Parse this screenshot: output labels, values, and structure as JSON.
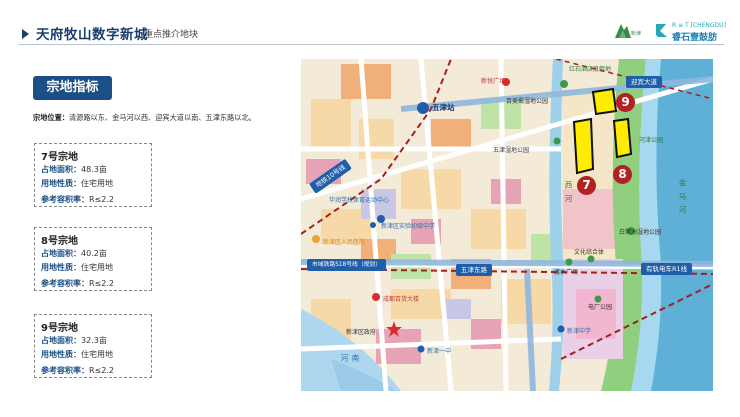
{
  "header": {
    "title": "天府牧山数字新城",
    "subtitle": "重点推介地块",
    "logo1_text": "新津",
    "logo2_en": "R ≡ T [CHENGDU]",
    "logo2_cn": "睿石壹鼓肪"
  },
  "section": {
    "title": "宗地指标",
    "location_label": "宗地位置：",
    "location_text": "清源路以东、金马河以西、迎宾大道以南、五津东路以北。"
  },
  "plots": [
    {
      "title": "7号宗地",
      "area_label": "占地面积：",
      "area": "48.3亩",
      "use_label": "用地性质：",
      "use": "住宅用地",
      "far_label": "参考容积率：",
      "far": "R≤2.2"
    },
    {
      "title": "8号宗地",
      "area_label": "占地面积：",
      "area": "40.2亩",
      "use_label": "用地性质：",
      "use": "住宅用地",
      "far_label": "参考容积率：",
      "far": "R≤2.2"
    },
    {
      "title": "9号宗地",
      "area_label": "占地面积：",
      "area": "32.3亩",
      "use_label": "用地性质：",
      "use": "住宅用地",
      "far_label": "参考容积率：",
      "far": "R≤2.2"
    }
  ],
  "map": {
    "roads": {
      "yingbin": "迎宾大道",
      "wujin_east": "五津东路",
      "line10": "地铁10号线",
      "s18": "市域铁路S18号线（规划）",
      "tram": "有轨电车R1线"
    },
    "stations": {
      "wujin": "五津站"
    },
    "plot_numbers": [
      "7",
      "8",
      "9"
    ],
    "labels": {
      "hongshi": "红石酒店度假地",
      "xinshi": "新悦广场",
      "baimei": "百美蜀湿地公园",
      "hejin": "河津公园",
      "wujin_park": "五津湿地公园",
      "jinma": "金马河",
      "xihe": "西河",
      "baidu": "白鹭洲湿地公园",
      "wenhua": "文化综合体",
      "dutian": "渡水广场",
      "school_sports": "华润学校体育运动中心",
      "shiyan": "新津区实验初级中学",
      "hospital": "新津区人民医院",
      "chengdu_bldg": "成都百货大楼",
      "gov": "新津区政府",
      "xinjin1": "新津一中",
      "dianchang": "电厂公园",
      "xinjin_mid": "新津中学",
      "nanhe": "南河"
    }
  }
}
